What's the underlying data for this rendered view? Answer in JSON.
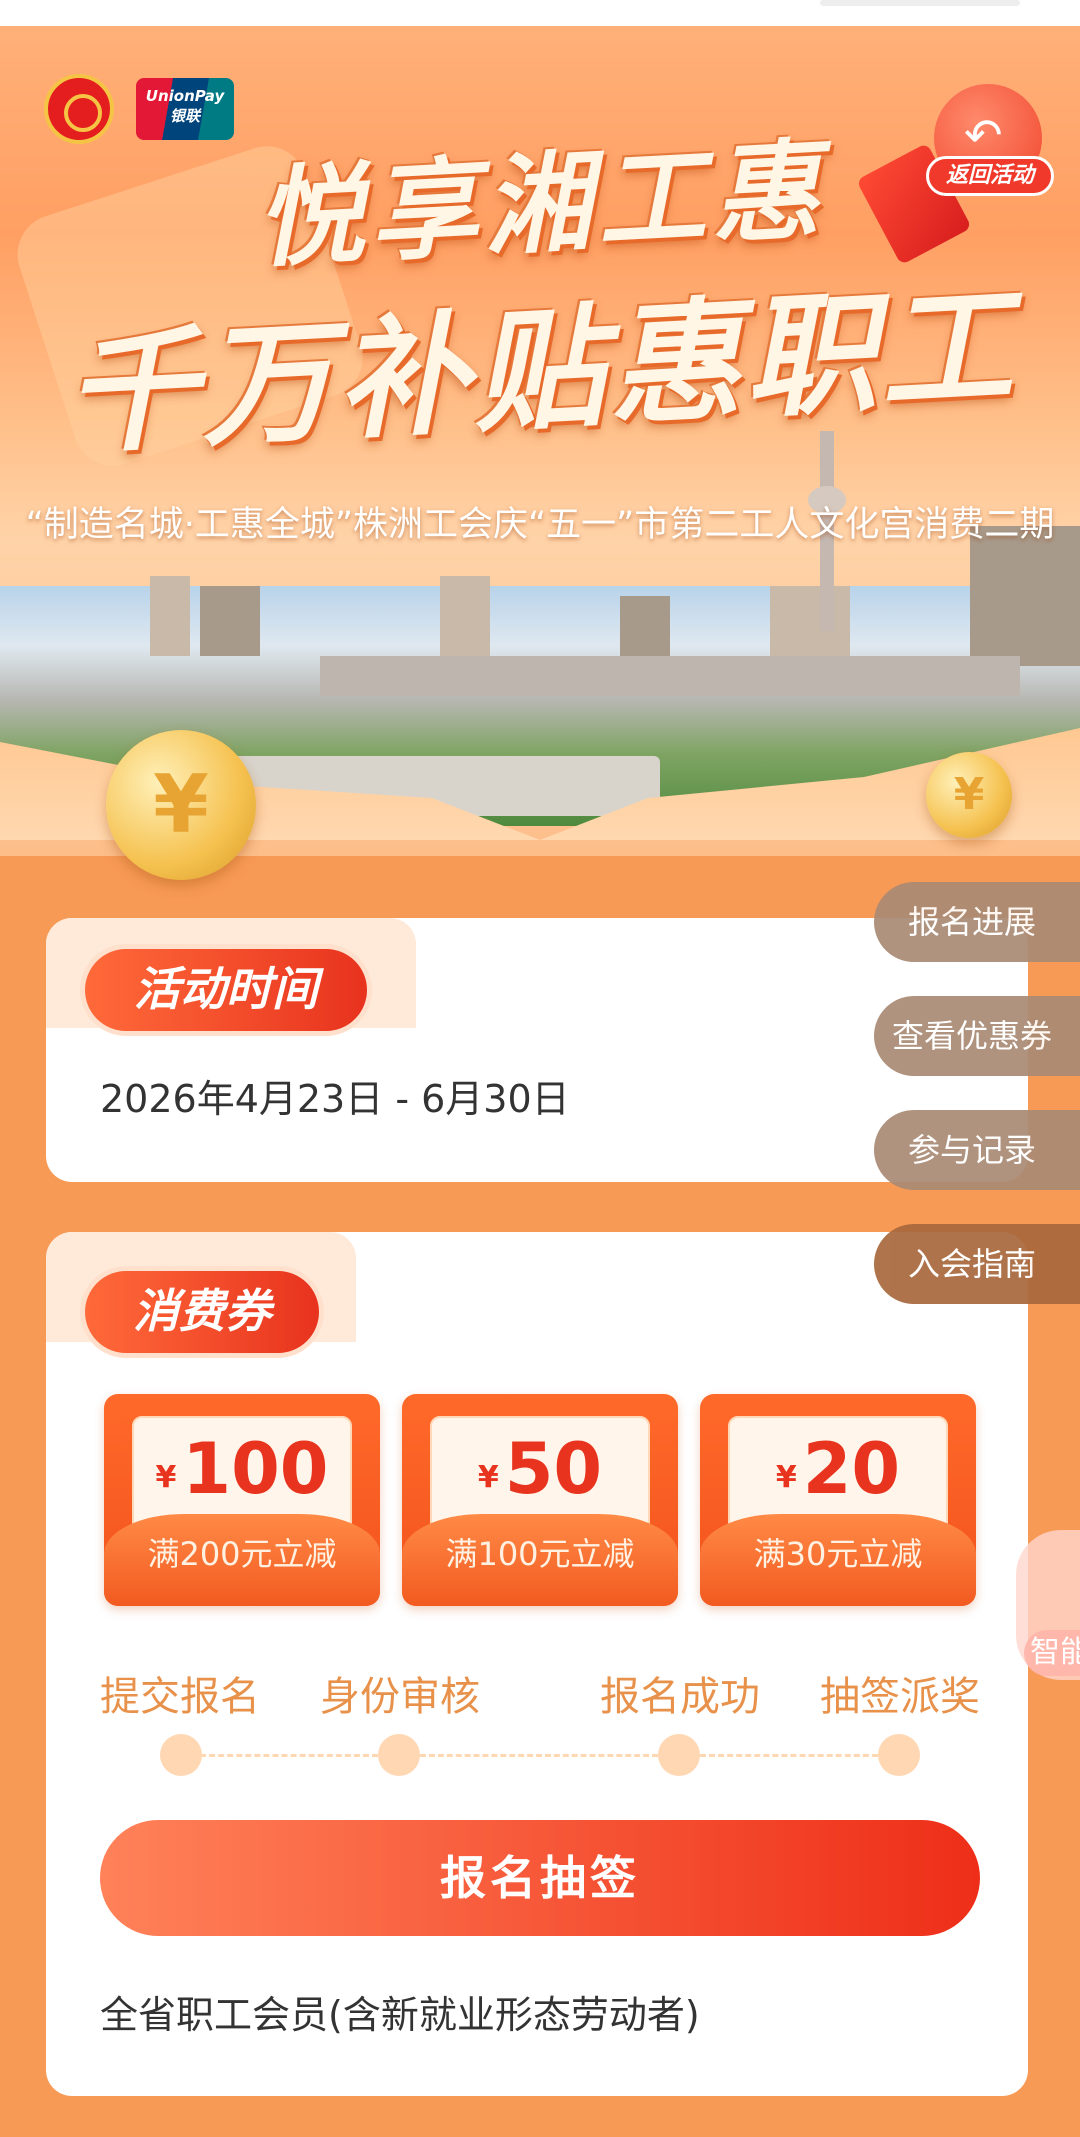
{
  "hero": {
    "title_line1": "悦享湘工惠",
    "title_line2": "千万补贴惠职工",
    "subtitle": "“制造名城·工惠全城”株洲工会庆“五一”市第二工人文化宫消费二期",
    "unionpay_logo": "UnionPay",
    "unionpay_logo_cn": "银联",
    "back_label": "返回活动",
    "back_icon": "undo-arrow-icon",
    "coin_symbol": "¥"
  },
  "side_menu": [
    "报名进展",
    "查看优惠券",
    "参与记录",
    "入会指南"
  ],
  "activity_time": {
    "tab_label": "活动时间",
    "value": "2026年4月23日 - 6月30日"
  },
  "coupons": {
    "tab_label": "消费券",
    "items": [
      {
        "currency": "¥",
        "amount": "100",
        "condition": "满200元立减"
      },
      {
        "currency": "¥",
        "amount": "50",
        "condition": "满100元立减"
      },
      {
        "currency": "¥",
        "amount": "20",
        "condition": "满30元立减"
      }
    ],
    "steps": [
      "提交报名",
      "身份审核",
      "报名成功",
      "抽签派奖"
    ],
    "apply_button": "报名抽签",
    "eligibility": "全省职工会员(含新就业形态劳动者)"
  },
  "assistant_label": "智能",
  "colors": {
    "page_bg": "#F79A55",
    "accent_red": "#E8331E",
    "accent_orange": "#FF6A2A",
    "step_text": "#E8914A"
  }
}
